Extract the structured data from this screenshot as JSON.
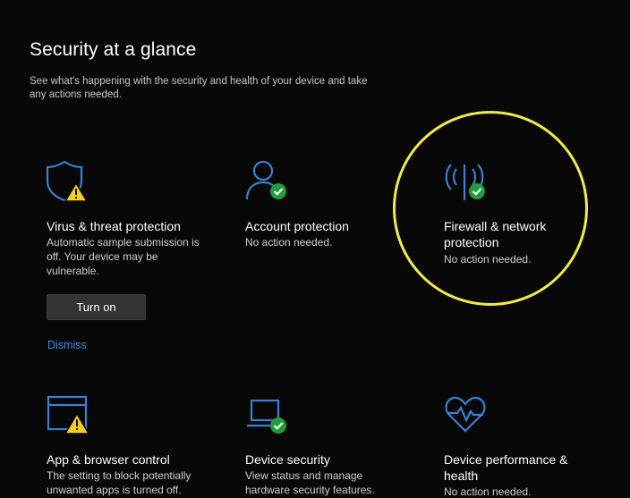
{
  "page": {
    "title": "Security at a glance",
    "subtitle": "See what's happening with the security and health of your device and take any actions needed."
  },
  "colors": {
    "background": "#080808",
    "accent_blue": "#3a7fd5",
    "warning_yellow": "#f2d022",
    "ok_green": "#1f9d3a",
    "highlight_circle": "#f2ea4a"
  },
  "cards": {
    "virus": {
      "icon": "shield-warning-icon",
      "title": "Virus & threat protection",
      "desc": "Automatic sample submission is off. Your device may be vulnerable.",
      "button": "Turn on",
      "link": "Dismiss"
    },
    "account": {
      "icon": "person-check-icon",
      "title": "Account protection",
      "desc": "No action needed."
    },
    "firewall": {
      "icon": "antenna-check-icon",
      "title_line1": "Firewall & network",
      "title_line2": "protection",
      "desc": "No action needed."
    },
    "app_browser": {
      "icon": "browser-window-warning-icon",
      "title": "App & browser control",
      "desc": "The setting to block potentially unwanted apps is turned off."
    },
    "device_security": {
      "icon": "laptop-check-icon",
      "title": "Device security",
      "desc": "View status and manage hardware security features."
    },
    "device_performance": {
      "icon": "heart-pulse-icon",
      "title_line1": "Device performance &",
      "title_line2": "health",
      "desc": "No action needed."
    }
  }
}
